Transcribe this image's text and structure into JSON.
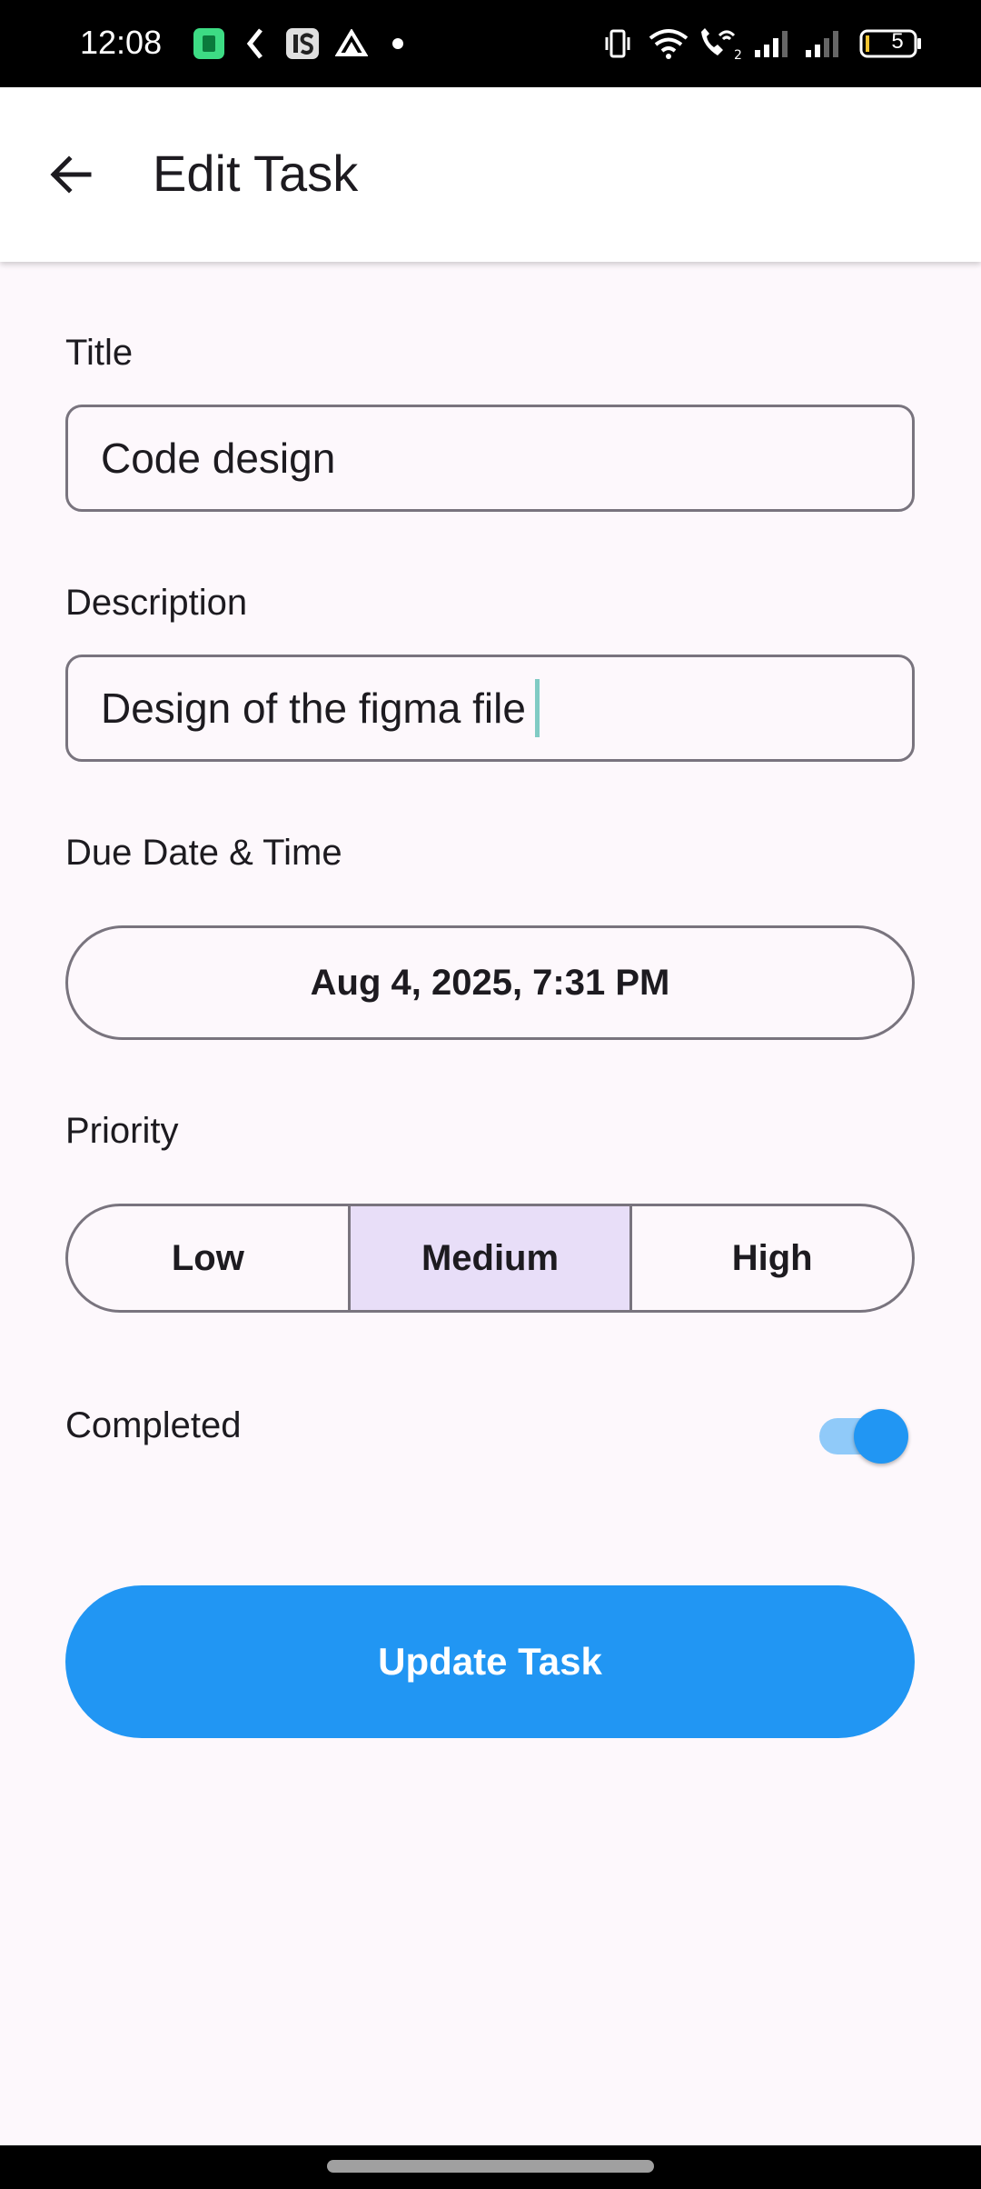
{
  "status_bar": {
    "time": "12:08",
    "battery_level": "5",
    "left_icons": [
      "app-notification-icon",
      "kotlin-icon",
      "is-app-icon",
      "drive-icon",
      "dot-icon"
    ],
    "right_icons": [
      "vibrate-icon",
      "wifi-icon",
      "wifi-call-icon",
      "signal-1-icon",
      "signal-2-icon",
      "battery-icon"
    ]
  },
  "app_bar": {
    "title": "Edit Task",
    "back_icon": "arrow-back-icon"
  },
  "form": {
    "title_label": "Title",
    "title_value": "Code design",
    "description_label": "Description",
    "description_value": "Design of the figma file",
    "due_label": "Due Date & Time",
    "due_value": "Aug 4, 2025, 7:31 PM",
    "priority_label": "Priority",
    "priority_options": [
      "Low",
      "Medium",
      "High"
    ],
    "priority_selected": "Medium",
    "completed_label": "Completed",
    "completed": true,
    "submit_label": "Update Task"
  },
  "colors": {
    "primary": "#2196f3",
    "selected_segment": "#e8def8",
    "outline": "#79747e",
    "background": "#fdf8fc"
  }
}
